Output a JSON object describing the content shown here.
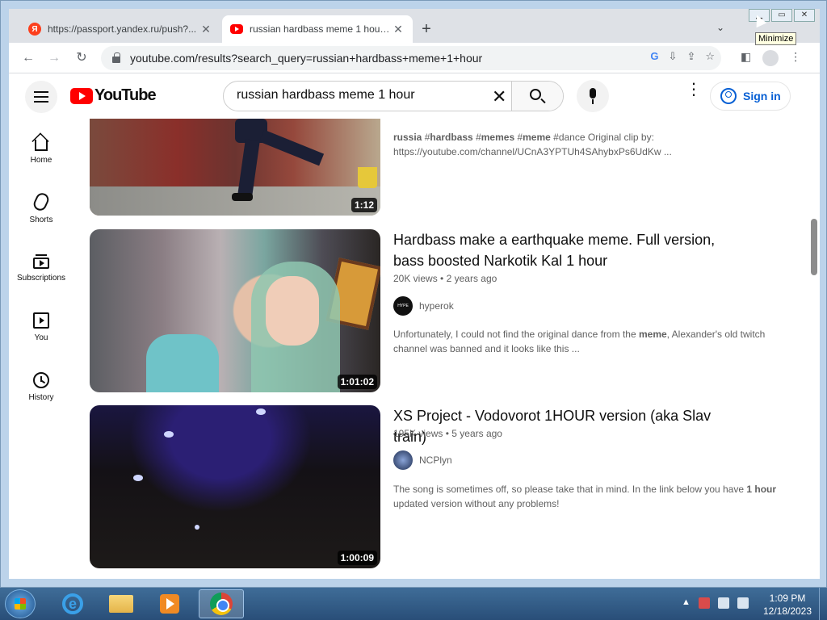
{
  "browser": {
    "tabs": [
      {
        "title": "https://passport.yandex.ru/push?...",
        "favicon": "yandex-icon",
        "active": false
      },
      {
        "title": "russian hardbass meme 1 hour - YouTube",
        "favicon": "youtube-icon",
        "active": true
      }
    ],
    "new_tab_label": "+",
    "url": "youtube.com/results?search_query=russian+hardbass+meme+1+hour",
    "tooltip": "Minimize"
  },
  "youtube": {
    "logo_text": "YouTube",
    "search_value": "russian hardbass meme 1 hour",
    "sign_in_label": "Sign in",
    "sidebar": [
      {
        "label": "Home",
        "icon": "home-icon"
      },
      {
        "label": "Shorts",
        "icon": "shorts-icon"
      },
      {
        "label": "Subscriptions",
        "icon": "subscriptions-icon"
      },
      {
        "label": "You",
        "icon": "you-icon"
      },
      {
        "label": "History",
        "icon": "history-icon"
      }
    ],
    "results": [
      {
        "duration": "1:12",
        "description_html": "<b>russia</b> #<b>hardbass</b> #<b>memes</b> #<b>meme</b> #dance Original clip by:<br>https://youtube.com/channel/UCnA3YPTUh4SAhybxPs6UdKw ..."
      },
      {
        "title": "Hardbass make a earthquake meme. Full version, bass boosted Narkotik Kal 1 hour",
        "views": "20K views",
        "age": "2 years ago",
        "channel": "hyperok",
        "channel_avatar_text": "HYPE",
        "duration": "1:01:02",
        "description_html": "Unfortunately, I could not find the original dance from the <b>meme</b>, Alexander's old twitch channel was banned and it looks like this ..."
      },
      {
        "title": "XS Project - Vodovorot 1HOUR version (aka Slav train)",
        "views": "195K views",
        "age": "5 years ago",
        "channel": "NCPlyn",
        "duration": "1:00:09",
        "description_html": "The song is sometimes off, so please take that in mind. In the link below you have <b>1 hour</b> updated version without any problems!"
      }
    ],
    "meta_separator": "•"
  },
  "taskbar": {
    "time": "1:09 PM",
    "date": "12/18/2023"
  },
  "colors": {
    "youtube_red": "#ff0000",
    "link_blue": "#065fd4",
    "taskbar": "#294e78"
  }
}
